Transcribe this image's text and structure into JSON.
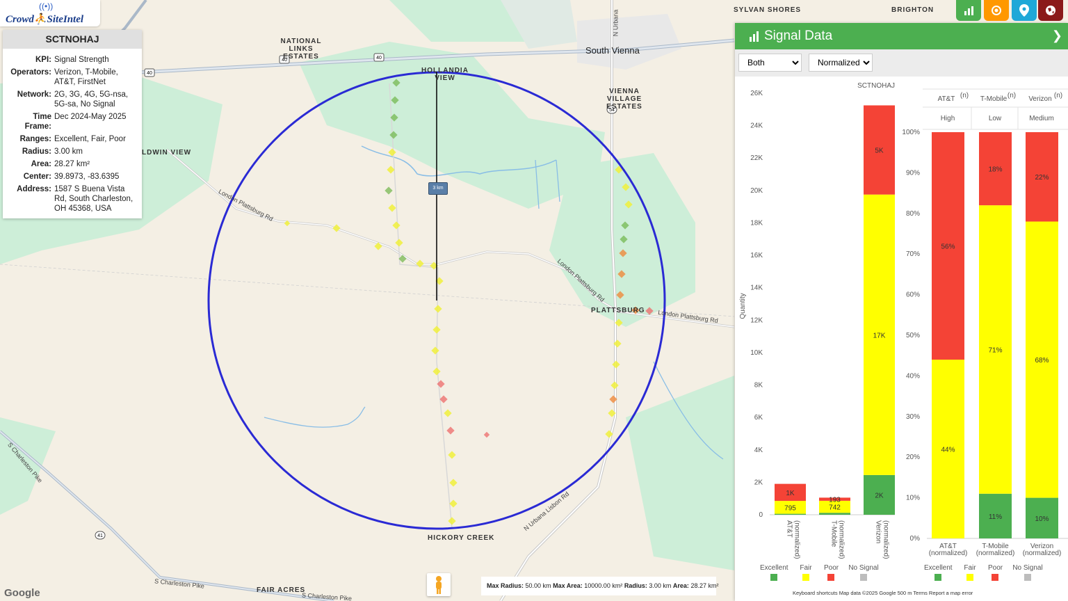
{
  "app": {
    "logo_text": "Crowd⛹SiteIntel"
  },
  "info": {
    "title": "SCTNOHAJ",
    "rows": [
      {
        "k": "KPI:",
        "v": "Signal Strength"
      },
      {
        "k": "Operators:",
        "v": "Verizon, T-Mobile, AT&T, FirstNet"
      },
      {
        "k": "Network:",
        "v": "2G, 3G, 4G, 5G-nsa, 5G-sa, No Signal"
      },
      {
        "k": "Time Frame:",
        "v": "Dec 2024-May 2025"
      },
      {
        "k": "Ranges:",
        "v": "Excellent, Fair, Poor"
      },
      {
        "k": "Radius:",
        "v": "3.00 km"
      },
      {
        "k": "Area:",
        "v": "28.27 km²"
      },
      {
        "k": "Center:",
        "v": "39.8973, -83.6395"
      },
      {
        "k": "Address:",
        "v": "1587 S Buena Vista Rd, South Charleston, OH 45368, USA"
      }
    ]
  },
  "map": {
    "labels": {
      "national_links": "NATIONAL\nLINKS ESTATES",
      "hollandia": "HOLLANDIA\nVIEW",
      "vienna_village": "VIENNA\nVILLAGE ESTATES",
      "south_vienna": "South Vienna",
      "sylvan": "SYLVAN SHORES",
      "brighton": "BRIGHTON",
      "baldwin": "LDWIN VIEW",
      "plattsburg": "PLATTSBURG",
      "hickory": "HICKORY CREEK",
      "fair_acres": "FAIR ACRES",
      "london_plattsburg_1": "London Plattsburg Rd",
      "london_plattsburg_2": "London Plattsburg Rd",
      "london_plattsburg_3": "London Plattsburg Rd",
      "urbana_lisbon": "N Urbana Lisbon Rd",
      "urbana": "N Urbana",
      "charleston_pike_1": "S Charleston Pike",
      "charleston_pike_2": "S Charleston Pike",
      "charleston_pike_3": "S Charleston Pike",
      "radius_marker": "3 km",
      "route40a": "40",
      "route40b": "40",
      "route40c": "40",
      "route54": "54",
      "route41": "41"
    },
    "bottom_info": {
      "max_radius_k": "Max Radius:",
      "max_radius_v": "50.00 km",
      "max_area_k": "Max Area:",
      "max_area_v": "10000.00 km²",
      "radius_k": "Radius:",
      "radius_v": "3.00 km",
      "area_k": "Area:",
      "area_v": "28.27 km²"
    },
    "google": "Google",
    "attribution": "Keyboard shortcuts     Map data ©2025 Google     500 m                    Terms     Report a map error"
  },
  "panel": {
    "title": "Signal Data",
    "select1": {
      "value": "Both",
      "options": [
        "Both"
      ]
    },
    "select2": {
      "value": "Normalized",
      "options": [
        "Normalized"
      ]
    },
    "chart_title": "SCTNOHAJ",
    "colors": {
      "excellent": "#4caf50",
      "fair": "#ffff00",
      "poor": "#f44336",
      "no_signal": "#bdbdbd"
    },
    "legend": [
      "Excellent",
      "Fair",
      "Poor",
      "No Signal"
    ],
    "operators_header": [
      {
        "name": "AT&T",
        "sup": "(n)",
        "level": "High",
        "color": "#4caf50"
      },
      {
        "name": "T-Mobile",
        "sup": "(n)",
        "level": "Low",
        "color": "#f44336"
      },
      {
        "name": "Verizon",
        "sup": "(n)",
        "level": "Medium",
        "color": "#ff9800"
      }
    ]
  },
  "chart_data": [
    {
      "type": "bar",
      "stacked": true,
      "title": "SCTNOHAJ",
      "ylabel": "Quantity",
      "ylim": [
        0,
        26000
      ],
      "yticks": [
        "0",
        "2K",
        "4K",
        "6K",
        "8K",
        "10K",
        "12K",
        "14K",
        "16K",
        "18K",
        "20K",
        "22K",
        "24K",
        "26K"
      ],
      "categories": [
        "AT&T\n(normalized)",
        "T-Mobile\n(normalized)",
        "Verizon\n(normalized)"
      ],
      "series": [
        {
          "name": "Excellent",
          "values": [
            60,
            120,
            2450
          ],
          "labels": [
            "",
            "",
            "2K"
          ]
        },
        {
          "name": "Fair",
          "values": [
            795,
            742,
            17300
          ],
          "labels": [
            "795",
            "742",
            "17K"
          ]
        },
        {
          "name": "Poor",
          "values": [
            1050,
            193,
            5500
          ],
          "labels": [
            "1K",
            "193",
            "5K"
          ]
        }
      ]
    },
    {
      "type": "bar",
      "stacked": true,
      "ylim": [
        0,
        100
      ],
      "yticks": [
        "0%",
        "10%",
        "20%",
        "30%",
        "40%",
        "50%",
        "60%",
        "70%",
        "80%",
        "90%",
        "100%"
      ],
      "categories": [
        "AT&T\n(normalized)",
        "T-Mobile\n(normalized)",
        "Verizon\n(normalized)"
      ],
      "series": [
        {
          "name": "Excellent",
          "values": [
            0,
            11,
            10
          ],
          "labels": [
            "",
            "11%",
            "10%"
          ]
        },
        {
          "name": "Fair",
          "values": [
            44,
            71,
            68
          ],
          "labels": [
            "44%",
            "71%",
            "68%"
          ]
        },
        {
          "name": "Poor",
          "values": [
            56,
            18,
            22
          ],
          "labels": [
            "56%",
            "18%",
            "22%"
          ]
        }
      ]
    }
  ]
}
